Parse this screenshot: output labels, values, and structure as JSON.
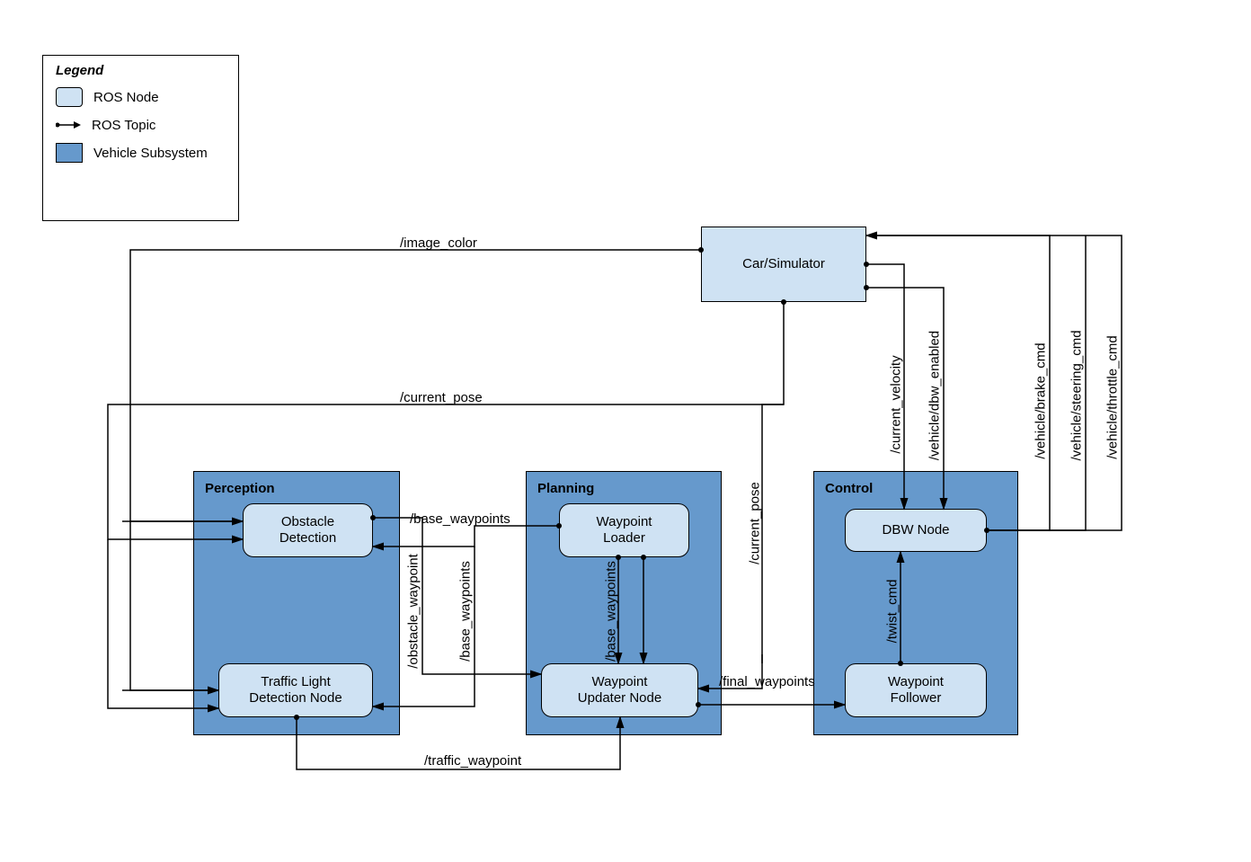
{
  "legend": {
    "title": "Legend",
    "ros_node": "ROS Node",
    "ros_topic": "ROS Topic",
    "vehicle_subsystem": "Vehicle Subsystem"
  },
  "subsystems": {
    "perception": {
      "title": "Perception"
    },
    "planning": {
      "title": "Planning"
    },
    "control": {
      "title": "Control"
    }
  },
  "nodes": {
    "car_simulator": "Car/Simulator",
    "obstacle_detection": "Obstacle\nDetection",
    "traffic_light_detection": "Traffic Light\nDetection Node",
    "waypoint_loader": "Waypoint\nLoader",
    "waypoint_updater": "Waypoint\nUpdater Node",
    "dbw_node": "DBW Node",
    "waypoint_follower": "Waypoint\nFollower"
  },
  "topics": {
    "image_color": "/image_color",
    "current_pose_h": "/current_pose",
    "current_pose_v": "/current_pose",
    "base_waypoints_1": "/base_waypoints",
    "base_waypoints_2": "/base_waypoints",
    "base_waypoints_3": "/base_waypoints",
    "obstacle_waypoint": "/obstacle_waypoint",
    "traffic_waypoint": "/traffic_waypoint",
    "final_waypoints": "/final_waypoints",
    "twist_cmd": "/twist_cmd",
    "current_velocity": "/current_velocity",
    "dbw_enabled": "/vehicle/dbw_enabled",
    "brake_cmd": "/vehicle/brake_cmd",
    "steering_cmd": "/vehicle/steering_cmd",
    "throttle_cmd": "/vehicle/throttle_cmd"
  }
}
